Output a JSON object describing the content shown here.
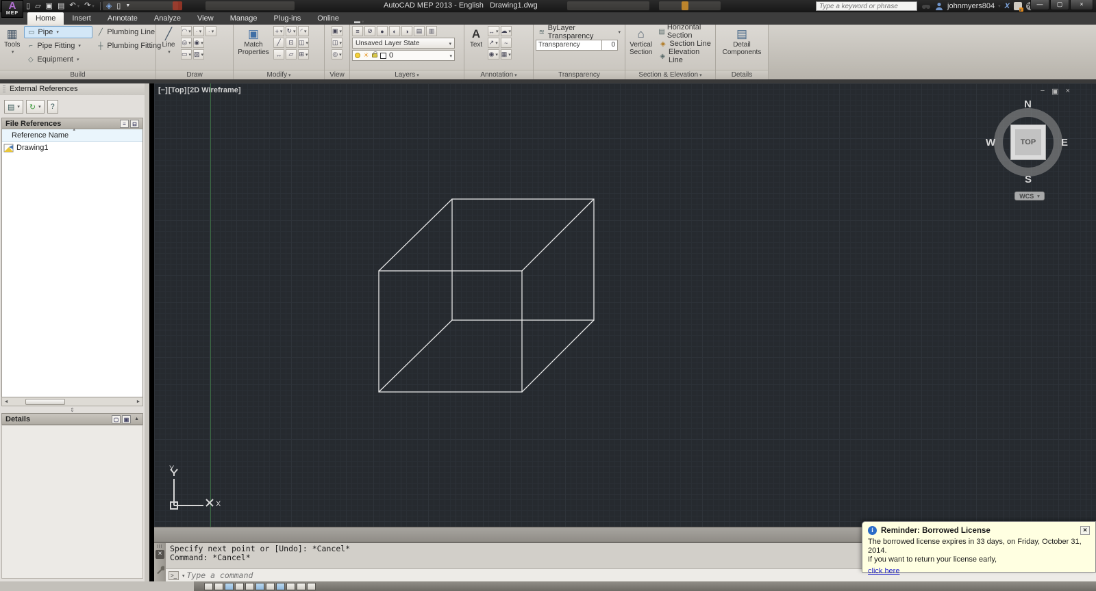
{
  "window": {
    "title": "AutoCAD MEP 2013 - English   Drawing1.dwg",
    "logo_letter": "A",
    "logo_label": "MEP",
    "controls": {
      "minimize": "—",
      "restore": "▢",
      "close": "×"
    }
  },
  "infocenter": {
    "search_placeholder": "Type a keyword or phrase",
    "username": "johnmyers804",
    "exchange": "X",
    "help": "?"
  },
  "tabs": [
    {
      "label": "Home"
    },
    {
      "label": "Insert"
    },
    {
      "label": "Annotate"
    },
    {
      "label": "Analyze"
    },
    {
      "label": "View"
    },
    {
      "label": "Manage"
    },
    {
      "label": "Plug-ins"
    },
    {
      "label": "Online"
    }
  ],
  "ribbon": {
    "build": {
      "label": "Build",
      "tools": "Tools",
      "pipe": "Pipe",
      "pipe_fitting": "Pipe Fitting",
      "equipment": "Equipment",
      "plumbing_line": "Plumbing Line",
      "plumbing_fitting": "Plumbing Fitting"
    },
    "draw": {
      "label": "Draw",
      "line": "Line"
    },
    "modify": {
      "label": "Modify",
      "match": "Match Properties"
    },
    "view": {
      "label": "View"
    },
    "layers": {
      "label": "Layers",
      "state": "Unsaved Layer State",
      "layer_name": "0"
    },
    "annotation": {
      "label": "Annotation",
      "text": "Text"
    },
    "transparency": {
      "label": "Transparency",
      "bylayer": "ByLayer Transparency",
      "field_label": "Transparency",
      "field_value": "0"
    },
    "section": {
      "label": "Section & Elevation",
      "vertical": "Vertical Section",
      "horizontal": "Horizontal Section",
      "section_line": "Section Line",
      "elevation_line": "Elevation Line"
    },
    "details": {
      "label": "Details",
      "big": "Detail Components"
    }
  },
  "palette": {
    "title": "External References",
    "file_references": "File References",
    "column_header": "Reference Name",
    "rows": [
      {
        "name": "Drawing1"
      }
    ],
    "details_header": "Details"
  },
  "viewport": {
    "minimize": "[−]",
    "view": "[Top]",
    "style": "[2D Wireframe]",
    "win_min": "−",
    "win_restore": "▣",
    "win_close": "×"
  },
  "viewcube": {
    "n": "N",
    "s": "S",
    "e": "E",
    "w": "W",
    "top": "TOP",
    "wcs": "WCS"
  },
  "ucs": {
    "x": "X",
    "y": "Y"
  },
  "command": {
    "history": [
      "Specify next point or [Undo]: *Cancel*",
      "Command: *Cancel*"
    ],
    "placeholder": "Type a command",
    "prompt_icon": ">_",
    "close_icon": "×"
  },
  "notification": {
    "title": "Reminder: Borrowed License",
    "line1": "The borrowed license expires in 33 days, on Friday, October 31, 2014.",
    "line2": "If you want to return your license early,",
    "link": "click here",
    "close": "×",
    "bg_color": "#ffffe1"
  },
  "icons": {
    "new": "▯",
    "open": "▱",
    "save": "▣",
    "print": "▤",
    "undo": "↶",
    "redo": "↷",
    "comm": "◈",
    "sheet": "▯",
    "qat_more": "▼",
    "tools": "▦",
    "pipe": "▭",
    "pipe_fitting": "⌐",
    "equipment": "◇",
    "plumbing_line": "╱",
    "plumbing_fitting": "┼",
    "line": "╱",
    "arc": "◠",
    "dot": "·",
    "circle": "◎",
    "ellipse": "◉",
    "rect": "▭",
    "hatch": "▨",
    "match": "▣",
    "move": "+",
    "rotate": "↻",
    "fillet": "◜",
    "erase": "╱",
    "copy": "⊡",
    "mirror": "◫",
    "stretch": "↔",
    "scale": "▱",
    "array": "⊞",
    "view1": "▣",
    "view2": "◫",
    "view3": "◎",
    "lay1": "≡",
    "lay2": "⊘",
    "lay3": "●",
    "lay4": "◐",
    "lay5": "◑",
    "lay6": "▤",
    "lay7": "▥",
    "sun": "☀",
    "text": "A",
    "dim": "↔",
    "cloud": "☁",
    "mleader": "↗",
    "squig": "~",
    "bubble": "◉",
    "table": "▦",
    "bylayer": "≋",
    "house": "⌂",
    "hsection": "▤",
    "sline": "◈",
    "eline": "◈",
    "detail": "▤",
    "attach": "▤",
    "refresh": "↻",
    "help": "?",
    "listview": "≡",
    "treeview": "⊟",
    "scroll_left": "◄",
    "scroll_right": "►",
    "split": "⇕",
    "det1": "▢",
    "det2": "▣",
    "collapse": "▲"
  },
  "colors": {
    "canvas_bg": "#262a2f",
    "axis_green": "#3c6b45",
    "selection_blue": "#d3e7f7",
    "notification_bg": "#ffffe1",
    "link_blue": "#2222cc",
    "wireframe": "#e6e6e6"
  }
}
